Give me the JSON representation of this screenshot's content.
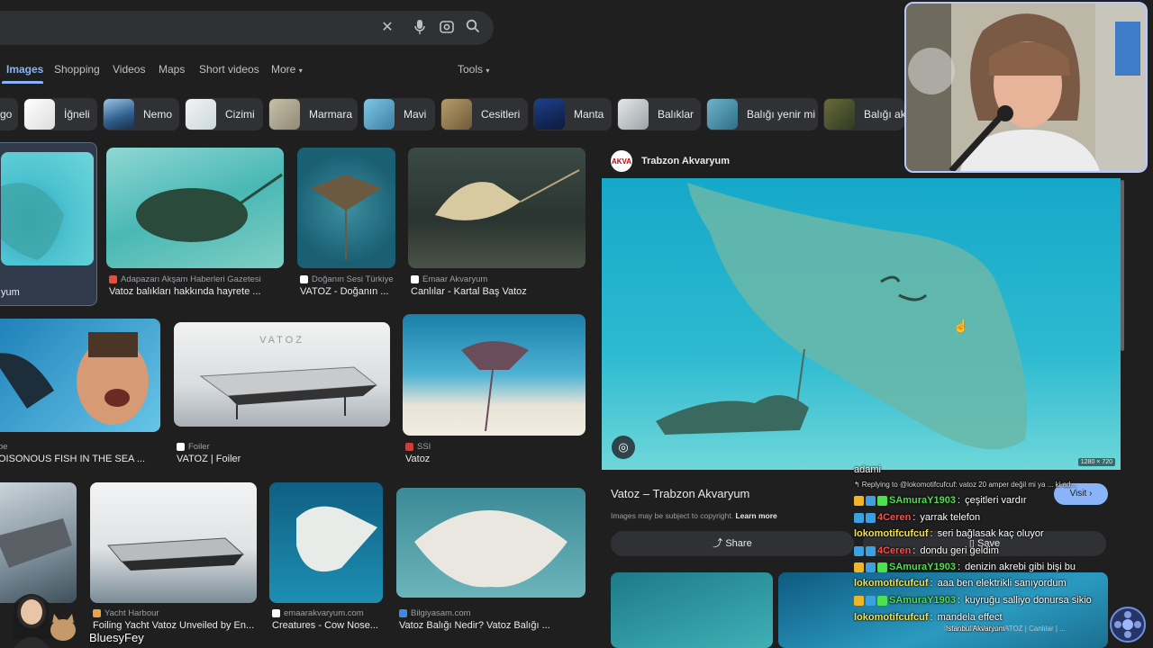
{
  "search": {
    "clear_icon": "close-icon",
    "mic_icon": "microphone-icon",
    "lens_icon": "camera-lens-icon",
    "search_icon": "search-icon"
  },
  "tabs": {
    "images": "Images",
    "shopping": "Shopping",
    "videos": "Videos",
    "maps": "Maps",
    "short_videos": "Short videos",
    "more": "More",
    "tools": "Tools"
  },
  "chips": [
    {
      "label": "go"
    },
    {
      "label": "İğneli"
    },
    {
      "label": "Nemo"
    },
    {
      "label": "Cizimi"
    },
    {
      "label": "Marmara"
    },
    {
      "label": "Mavi"
    },
    {
      "label": "Cesitleri"
    },
    {
      "label": "Manta"
    },
    {
      "label": "Balıklar"
    },
    {
      "label": "Balığı yenir mi"
    },
    {
      "label": "Balığı akv"
    }
  ],
  "results": {
    "r1": {
      "source": "",
      "title": "yum"
    },
    "r2": {
      "source": "Adapazarı Akşam Haberleri Gazetesi",
      "title": "Vatoz balıkları hakkında hayrete ..."
    },
    "r3": {
      "source": "Doğanın Sesi Türkiye",
      "title": "VATOZ - Doğanın ..."
    },
    "r4": {
      "source": "Emaar Akvaryum",
      "title": "Canlılar - Kartal Baş Vatoz"
    },
    "r5": {
      "source": "be",
      "title": "OISONOUS FISH IN THE SEA ..."
    },
    "r6": {
      "source": "Foiler",
      "title": "VATOZ | Foiler",
      "boat_text": "VATOZ"
    },
    "r7": {
      "source": "SSI",
      "title": "Vatoz"
    },
    "r8": {
      "source": "Yacht Harbour",
      "title": "Foiling Yacht Vatoz Unveiled by En..."
    },
    "r9": {
      "source": "emaarakvaryum.com",
      "title": "Creatures - Cow Nose..."
    },
    "r10": {
      "source": "Bilgiyasam.com",
      "title": "Vatoz Balığı Nedir? Vatoz Balığı ..."
    }
  },
  "panel": {
    "site": "Trabzon Akvaryum",
    "logo_text": "AKVA",
    "title": "Vatoz – Trabzon Akvaryum",
    "copyright": "Images may be subject to copyright.",
    "learn_more": "Learn more",
    "visit": "Visit",
    "share": "Share",
    "save": "Save",
    "dims": "1280 × 720",
    "related_caption": "İNEK BURUNLU-VATOZ | Canlılar | ..."
  },
  "chat": {
    "top": "adami",
    "reply": "Replying to @lokomotifcufcuf: vatoz 20 amper değil mi ya  ...  ki ad...",
    "messages": [
      {
        "user": "SAmuraY1903",
        "text": "çeşitleri vardır",
        "color": "#4ee04e"
      },
      {
        "user": "4Ceren",
        "text": "yarrak telefon",
        "color": "#ff4b4b"
      },
      {
        "user": "lokomotifcufcuf",
        "text": "seri bağlasak kaç oluyor",
        "color": "#f5e04b"
      },
      {
        "user": "4Ceren",
        "text": "dondu geri geldim",
        "color": "#ff4b4b"
      },
      {
        "user": "SAmuraY1903",
        "text": "denizin akrebi gibi bişi bu",
        "color": "#4ee04e"
      },
      {
        "user": "lokomotifcufcuf",
        "text": "aaa ben elektrikli sanıyordum",
        "color": "#f5e04b"
      },
      {
        "user": "SAmuraY1903",
        "text": "kuyruğu salliyo donursa sikio",
        "color": "#4ee04e"
      },
      {
        "user": "lokomotifcufcuf",
        "text": "mandela effect",
        "color": "#f5e04b"
      }
    ],
    "istanbul": "Istanbul Akvaryum"
  },
  "streamer": "BluesyFey"
}
